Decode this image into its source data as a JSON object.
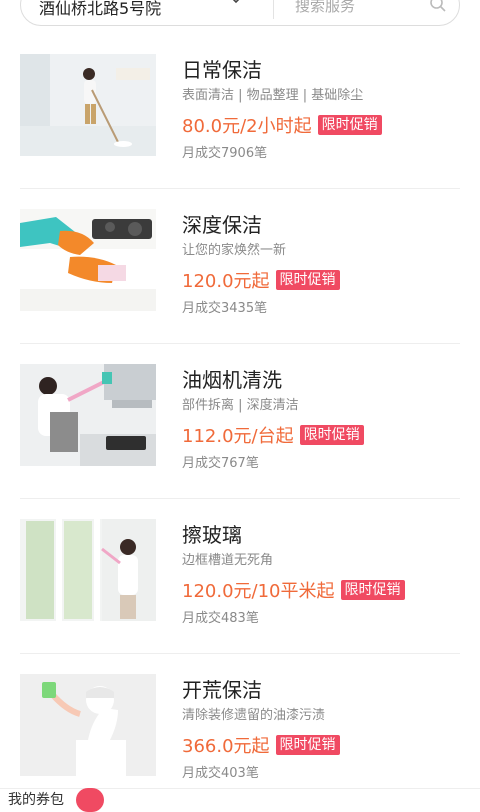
{
  "header": {
    "address": "酒仙桥北路5号院",
    "search_placeholder": "搜索服务"
  },
  "services": [
    {
      "title": "日常保洁",
      "desc": "表面清洁 | 物品整理 | 基础除尘",
      "price": "80.0元/2小时起",
      "badge": "限时促销",
      "sales": "月成交7906笔"
    },
    {
      "title": "深度保洁",
      "desc": "让您的家焕然一新",
      "price": "120.0元起",
      "badge": "限时促销",
      "sales": "月成交3435笔"
    },
    {
      "title": "油烟机清洗",
      "desc": "部件拆离 | 深度清洁",
      "price": "112.0元/台起",
      "badge": "限时促销",
      "sales": "月成交767笔"
    },
    {
      "title": "擦玻璃",
      "desc": "边框槽道无死角",
      "price": "120.0元/10平米起",
      "badge": "限时促销",
      "sales": "月成交483笔"
    },
    {
      "title": "开荒保洁",
      "desc": "清除装修遗留的油漆污渍",
      "price": "366.0元起",
      "badge": "限时促销",
      "sales": "月成交403笔"
    }
  ],
  "bottom": {
    "coupon_label": "我的券包"
  },
  "colors": {
    "price": "#f06a3a",
    "badge": "#f04a62"
  }
}
